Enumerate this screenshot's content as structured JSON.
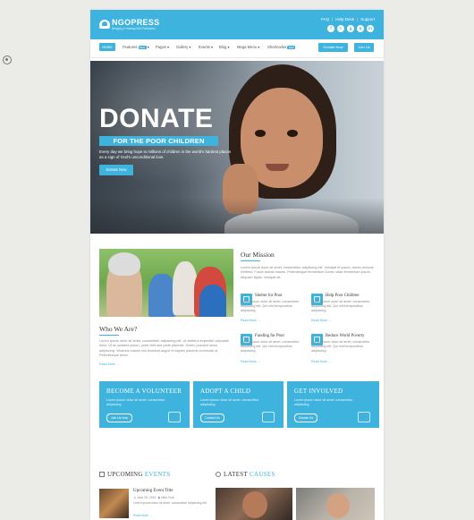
{
  "brand": {
    "name": "NGOPRESS",
    "tagline": "Bringing & Hosting NGO Websites",
    "accent": "#3eb3de"
  },
  "toplinks": [
    "FAQ",
    "Help Desk",
    "Support"
  ],
  "socials": [
    "facebook-icon",
    "twitter-icon",
    "google-plus-icon",
    "pinterest-icon",
    "linkedin-icon"
  ],
  "nav": {
    "items": [
      {
        "label": "Home",
        "badge": "",
        "active": true
      },
      {
        "label": "Features",
        "badge": "New",
        "active": false
      },
      {
        "label": "Pages",
        "badge": "",
        "active": false
      },
      {
        "label": "Gallery",
        "badge": "",
        "active": false
      },
      {
        "label": "Events",
        "badge": "",
        "active": false
      },
      {
        "label": "Blog",
        "badge": "",
        "active": false
      },
      {
        "label": "Mega Menu",
        "badge": "",
        "active": false
      },
      {
        "label": "Shortcodes",
        "badge": "New",
        "active": false
      }
    ],
    "donate_label": "Donate Now",
    "join_label": "Join Us"
  },
  "hero": {
    "title": "DONATE",
    "subtitle": "FOR THE POOR CHILDREN",
    "text": "Every day we bring hope to millions of children in the world's hardest places as a sign of God's unconditional love.",
    "button": "Donate Now"
  },
  "about": {
    "title": "Who We Are?",
    "text": "Lorem ipsum dolor sit amet, consectetur adipiscing elit. Ut eleifend imperdiet vulputate dolor. Ut ac sodales ipsum, porta velit sed pede placerat. Donec posuere lacus adipiscing. Vivamus mauris nisi tincidunt augue et sapien placerat commodo id. Pellentesque tortor.",
    "readmore": "Read More →"
  },
  "mission": {
    "title": "Our Mission",
    "text": "Lorem ipsum dolor sit amet, consectetur adipiscing elit. Volutpat et ipsum, donec tempus eleifend. Fusce lacinia mauris. Pellentesque fermentum Donec vitae fermentum ipsum. Aliquam ligula. Volutpat sit.",
    "items": [
      {
        "title": "Shelter for Poor",
        "text": "Lorem ipsum dolor sit amet, consectetur adipiscing elit. Qui nihil tempoothus adipiscing.",
        "readmore": "Read More →"
      },
      {
        "title": "Help Poor Children",
        "text": "Lorem ipsum dolor sit amet, consectetur adipiscing elit. Qui nihil tempoothus adipiscing.",
        "readmore": "Read More →"
      },
      {
        "title": "Funding for Poor",
        "text": "Lorem ipsum dolor sit amet, consectetur adipiscing elit. Qui nihil tempoothus adipiscing.",
        "readmore": "Read More →"
      },
      {
        "title": "Reduce World Poverty",
        "text": "Lorem ipsum dolor sit amet, consectetur adipiscing elit. Qui nihil tempoothus adipiscing.",
        "readmore": "Read More →"
      }
    ]
  },
  "cta": [
    {
      "title": "BECOME A VOLUNTEER",
      "text": "Lorem ipsum dolor sit amet, consectetur adipiscing.",
      "button": "Join Us Now"
    },
    {
      "title": "ADOPT A CHILD",
      "text": "Lorem ipsum dolor sit amet, consectetur adipiscing.",
      "button": "Contact Us"
    },
    {
      "title": "GET INVOLVED",
      "text": "Lorem ipsum dolor sit amet, consectetur adipiscing.",
      "button": "Donate Us"
    }
  ],
  "events": {
    "title_main": "UPCOMING",
    "title_accent": "EVENTS",
    "item_title": "Upcoming Event Title",
    "item_date": "June 25, 2015",
    "item_location": "New York",
    "item_text": "Lorem ipsum dolor sit amet, consectetur adipiscing elit.",
    "item_readmore": "Read More →"
  },
  "causes": {
    "title_main": "LATEST",
    "title_accent": "CAUSES"
  }
}
